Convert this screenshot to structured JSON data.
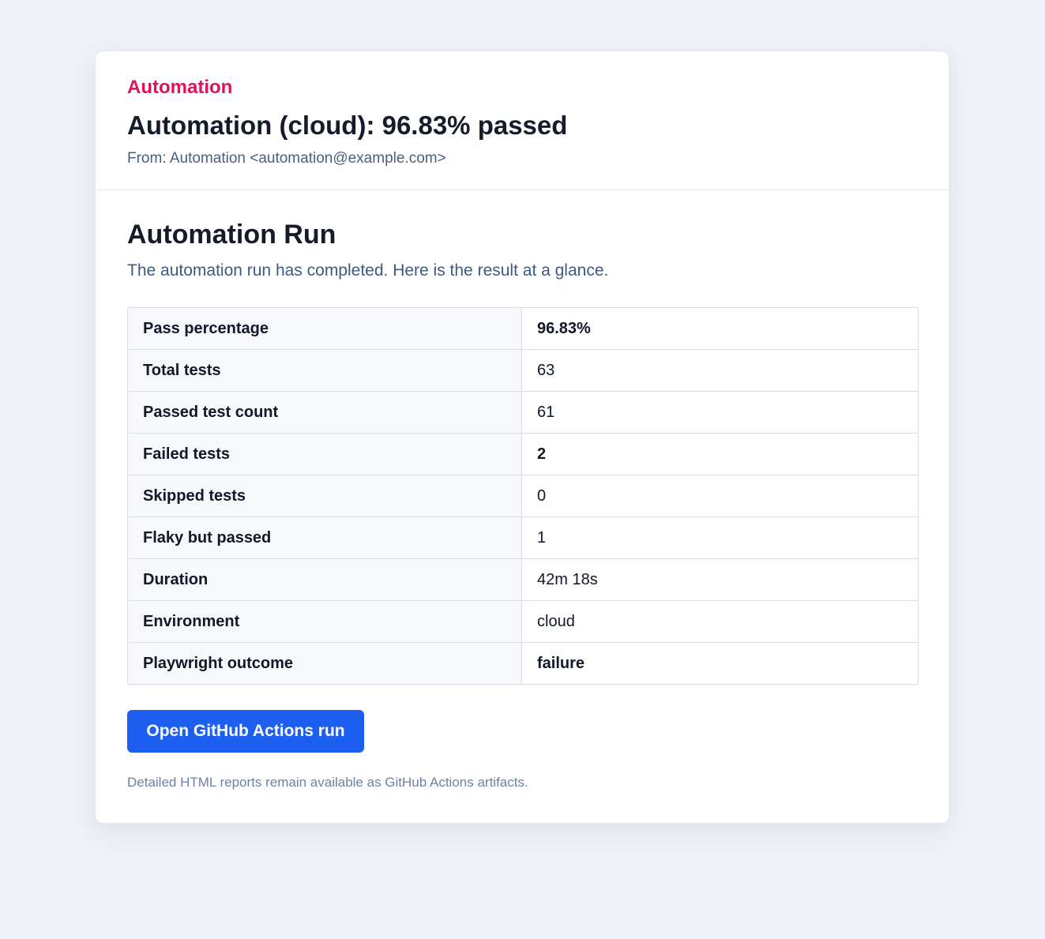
{
  "header": {
    "brand": "Automation",
    "subject": "Automation (cloud): 96.83% passed",
    "from": "From: Automation <automation@example.com>"
  },
  "body": {
    "title": "Automation Run",
    "intro": "The automation run has completed. Here is the result at a glance.",
    "rows": [
      {
        "label": "Pass percentage",
        "value": "96.83%",
        "status": "good"
      },
      {
        "label": "Total tests",
        "value": "63",
        "status": "normal"
      },
      {
        "label": "Passed test count",
        "value": "61",
        "status": "normal"
      },
      {
        "label": "Failed tests",
        "value": "2",
        "status": "bad"
      },
      {
        "label": "Skipped tests",
        "value": "0",
        "status": "normal"
      },
      {
        "label": "Flaky but passed",
        "value": "1",
        "status": "normal"
      },
      {
        "label": "Duration",
        "value": "42m 18s",
        "status": "normal"
      },
      {
        "label": "Environment",
        "value": "cloud",
        "status": "normal"
      },
      {
        "label": "Playwright outcome",
        "value": "failure",
        "status": "bad"
      }
    ],
    "button_label": "Open GitHub Actions run",
    "footnote": "Detailed HTML reports remain available as GitHub Actions artifacts."
  },
  "colors": {
    "brand": "#e0115f",
    "good": "#15803d",
    "bad": "#c81e1e",
    "button": "#1d5ff0",
    "background": "#eef1f6"
  }
}
